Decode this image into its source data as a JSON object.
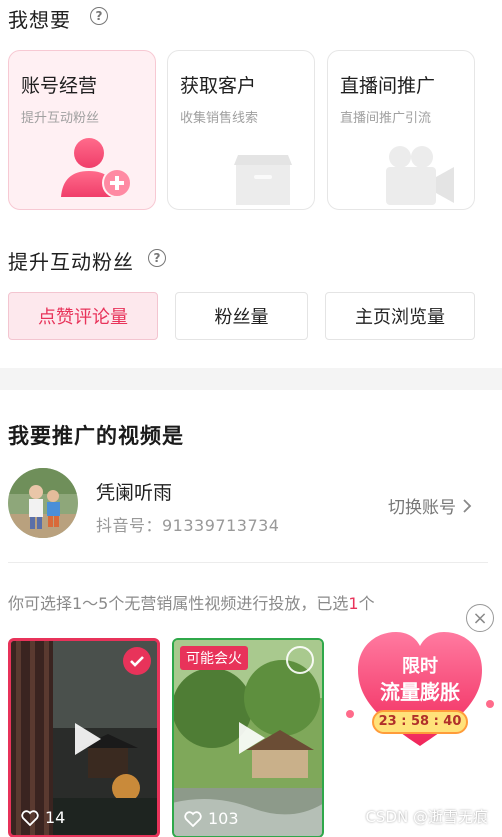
{
  "want": {
    "title": "我想要",
    "help": "?"
  },
  "goals": [
    {
      "title": "账号经营",
      "sub": "提升互动粉丝",
      "icon": "user-add-icon",
      "active": true
    },
    {
      "title": "获取客户",
      "sub": "收集销售线索",
      "icon": "box-icon",
      "active": false
    },
    {
      "title": "直播间推广",
      "sub": "直播间推广引流",
      "icon": "video-camera-icon",
      "active": false
    }
  ],
  "metrics": {
    "title": "提升互动粉丝",
    "help": "?",
    "options": [
      "点赞评论量",
      "粉丝量",
      "主页浏览量"
    ],
    "selected": "点赞评论量"
  },
  "video": {
    "title": "我要推广的视频是",
    "account_name": "凭阑听雨",
    "account_id": "抖音号：91339713734",
    "switch_label": "切换账号",
    "hint_prefix": "你可选择1～5个无营销属性视频进行投放，已选",
    "hint_count": "1",
    "hint_suffix": "个"
  },
  "thumbs": [
    {
      "likes": "14",
      "selected": true,
      "badge": ""
    },
    {
      "likes": "103",
      "selected": false,
      "badge": "可能会火"
    }
  ],
  "promo": {
    "line1": "限时",
    "line2": "流量膨胀",
    "timer": "23 : 58 : 40"
  },
  "watermark": "CSDN @逝雪无痕",
  "colors": {
    "accent": "#e8335a",
    "active_bg": "#fff0f3"
  }
}
